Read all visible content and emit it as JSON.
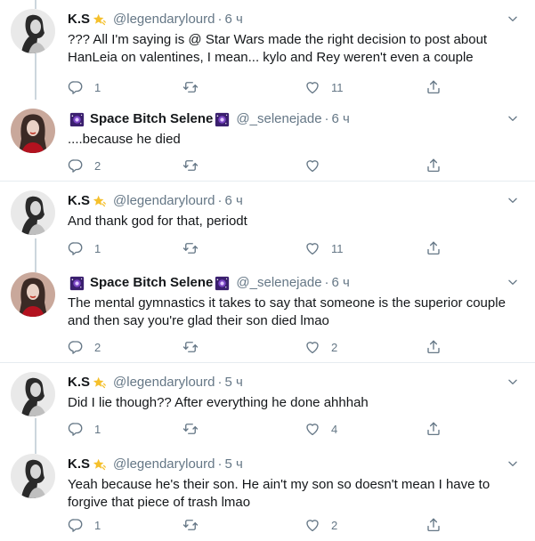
{
  "tweets": [
    {
      "name": "K.S",
      "handle": "@legendarylourd",
      "time": "6 ч",
      "text": "??? All I'm saying is @ Star Wars made the right decision to post about HanLeia on valentines, I mean... kylo and Rey weren't even a couple",
      "replies": "1",
      "retweets": "",
      "likes": "11",
      "avatar": "ks",
      "emoji": "star-emoji"
    },
    {
      "name": "Space Bitch Selene",
      "handle": "@_selenejade",
      "time": "6 ч",
      "text": "....because he died",
      "replies": "2",
      "retweets": "",
      "likes": "",
      "avatar": "selene",
      "emoji": "galaxy-emoji"
    },
    {
      "name": "K.S",
      "handle": "@legendarylourd",
      "time": "6 ч",
      "text": "And thank god for that, periodt",
      "replies": "1",
      "retweets": "",
      "likes": "11",
      "avatar": "ks",
      "emoji": "star-emoji"
    },
    {
      "name": "Space Bitch Selene",
      "handle": "@_selenejade",
      "time": "6 ч",
      "text": "The mental gymnastics it takes to say that someone is the superior couple and then say you're glad their son died lmao",
      "replies": "2",
      "retweets": "",
      "likes": "2",
      "avatar": "selene",
      "emoji": "galaxy-emoji"
    },
    {
      "name": "K.S",
      "handle": "@legendarylourd",
      "time": "5 ч",
      "text": "Did I lie though?? After everything he done ahhhah",
      "replies": "1",
      "retweets": "",
      "likes": "4",
      "avatar": "ks",
      "emoji": "star-emoji"
    },
    {
      "name": "K.S",
      "handle": "@legendarylourd",
      "time": "5 ч",
      "text": "Yeah because he's their son. He ain't my son so doesn't mean I have to forgive that piece of trash lmao",
      "replies": "1",
      "retweets": "",
      "likes": "2",
      "avatar": "ks",
      "emoji": "star-emoji"
    }
  ],
  "colors": {
    "text": "#14171a",
    "secondary": "#657786",
    "thread_line": "#ccd6dd",
    "divider": "#e6ecf0"
  },
  "icons": [
    "reply-icon",
    "retweet-icon",
    "like-icon",
    "share-icon",
    "caret-down-icon"
  ]
}
